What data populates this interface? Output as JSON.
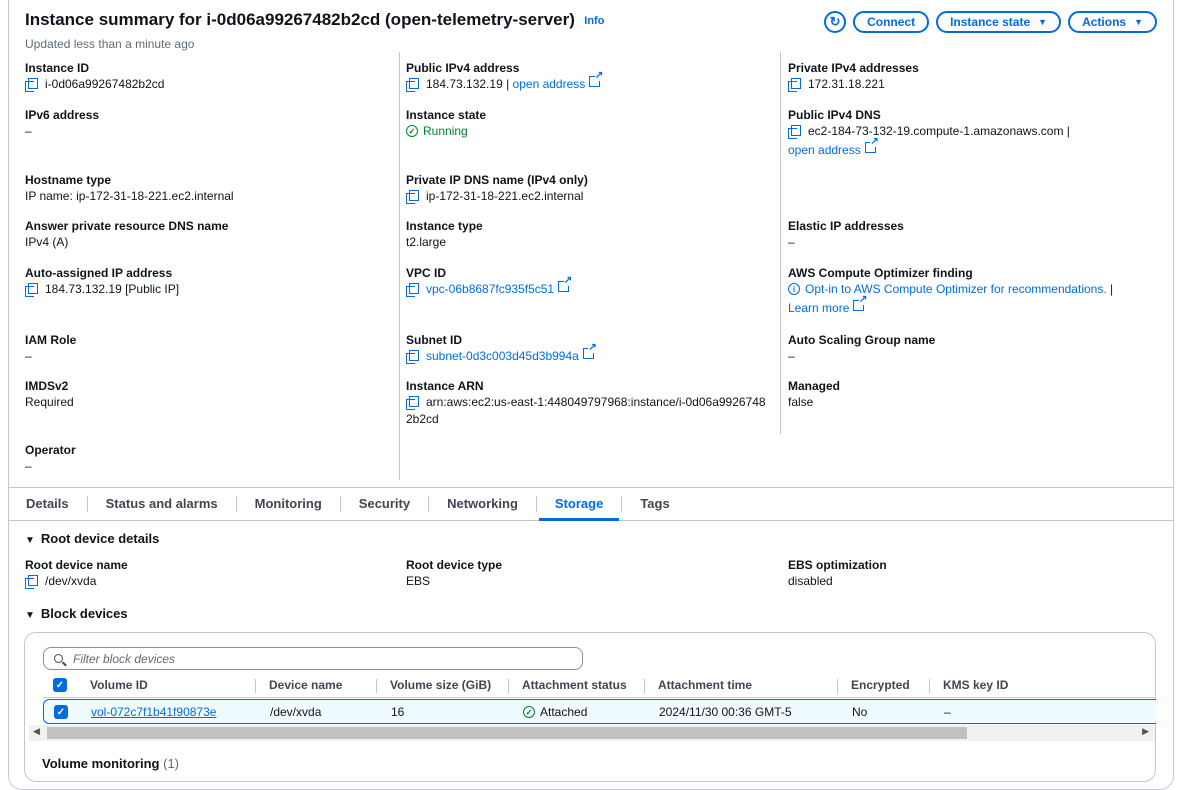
{
  "header": {
    "title": "Instance summary for i-0d06a99267482b2cd (open-telemetry-server)",
    "info": "Info",
    "updated": "Updated less than a minute ago",
    "buttons": {
      "refresh_icon": "refresh-icon",
      "connect": "Connect",
      "instance_state": "Instance state",
      "actions": "Actions"
    }
  },
  "details": {
    "instance_id": {
      "label": "Instance ID",
      "value": "i-0d06a99267482b2cd"
    },
    "ipv6": {
      "label": "IPv6 address",
      "value": "–"
    },
    "hostname_type": {
      "label": "Hostname type",
      "value": "IP name: ip-172-31-18-221.ec2.internal"
    },
    "answer_dns": {
      "label": "Answer private resource DNS name",
      "value": "IPv4 (A)"
    },
    "auto_ip": {
      "label": "Auto-assigned IP address",
      "value": "184.73.132.19 [Public IP]"
    },
    "iam_role": {
      "label": "IAM Role",
      "value": "–"
    },
    "imdsv2": {
      "label": "IMDSv2",
      "value": "Required"
    },
    "operator": {
      "label": "Operator",
      "value": "–"
    },
    "public_ipv4": {
      "label": "Public IPv4 address",
      "value": "184.73.132.19",
      "sep": " | ",
      "link": "open address"
    },
    "instance_state": {
      "label": "Instance state",
      "value": "Running"
    },
    "private_dns": {
      "label": "Private IP DNS name (IPv4 only)",
      "value": "ip-172-31-18-221.ec2.internal"
    },
    "instance_type": {
      "label": "Instance type",
      "value": "t2.large"
    },
    "vpc_id": {
      "label": "VPC ID",
      "value": "vpc-06b8687fc935f5c51"
    },
    "subnet_id": {
      "label": "Subnet ID",
      "value": "subnet-0d3c003d45d3b994a"
    },
    "arn": {
      "label": "Instance ARN",
      "value_line1": "arn:aws:ec2:us-east-1:448049797968:instance/i-0d06a9926748",
      "value_line2": "2b2cd"
    },
    "private_ipv4": {
      "label": "Private IPv4 addresses",
      "value": "172.31.18.221"
    },
    "public_dns": {
      "label": "Public IPv4 DNS",
      "value": "ec2-184-73-132-19.compute-1.amazonaws.com",
      "sep": " |",
      "link": "open address"
    },
    "elastic_ip": {
      "label": "Elastic IP addresses",
      "value": "–"
    },
    "optimizer": {
      "label": "AWS Compute Optimizer finding",
      "value": "Opt-in to AWS Compute Optimizer for recommendations.",
      "sep": " |",
      "link": "Learn more"
    },
    "asg": {
      "label": "Auto Scaling Group name",
      "value": "–"
    },
    "managed": {
      "label": "Managed",
      "value": "false"
    }
  },
  "tabs": [
    "Details",
    "Status and alarms",
    "Monitoring",
    "Security",
    "Networking",
    "Storage",
    "Tags"
  ],
  "active_tab": "Storage",
  "storage": {
    "root_heading": "Root device details",
    "root_name": {
      "label": "Root device name",
      "value": "/dev/xvda"
    },
    "root_type": {
      "label": "Root device type",
      "value": "EBS"
    },
    "ebs_opt": {
      "label": "EBS optimization",
      "value": "disabled"
    },
    "block_heading": "Block devices",
    "filter_placeholder": "Filter block devices",
    "columns": [
      "Volume ID",
      "Device name",
      "Volume size (GiB)",
      "Attachment status",
      "Attachment time",
      "Encrypted",
      "KMS key ID"
    ],
    "rows": [
      {
        "volume_id": "vol-072c7f1b41f90873e",
        "device": "/dev/xvda",
        "size": "16",
        "status": "Attached",
        "time": "2024/11/30 00:36 GMT-5",
        "encrypted": "No",
        "kms": "–"
      }
    ],
    "volume_monitoring": "Volume monitoring",
    "volume_monitoring_count": "(1)"
  },
  "colors": {
    "link": "#006ce0",
    "success": "#00802f",
    "border": "#c6c6cd"
  }
}
